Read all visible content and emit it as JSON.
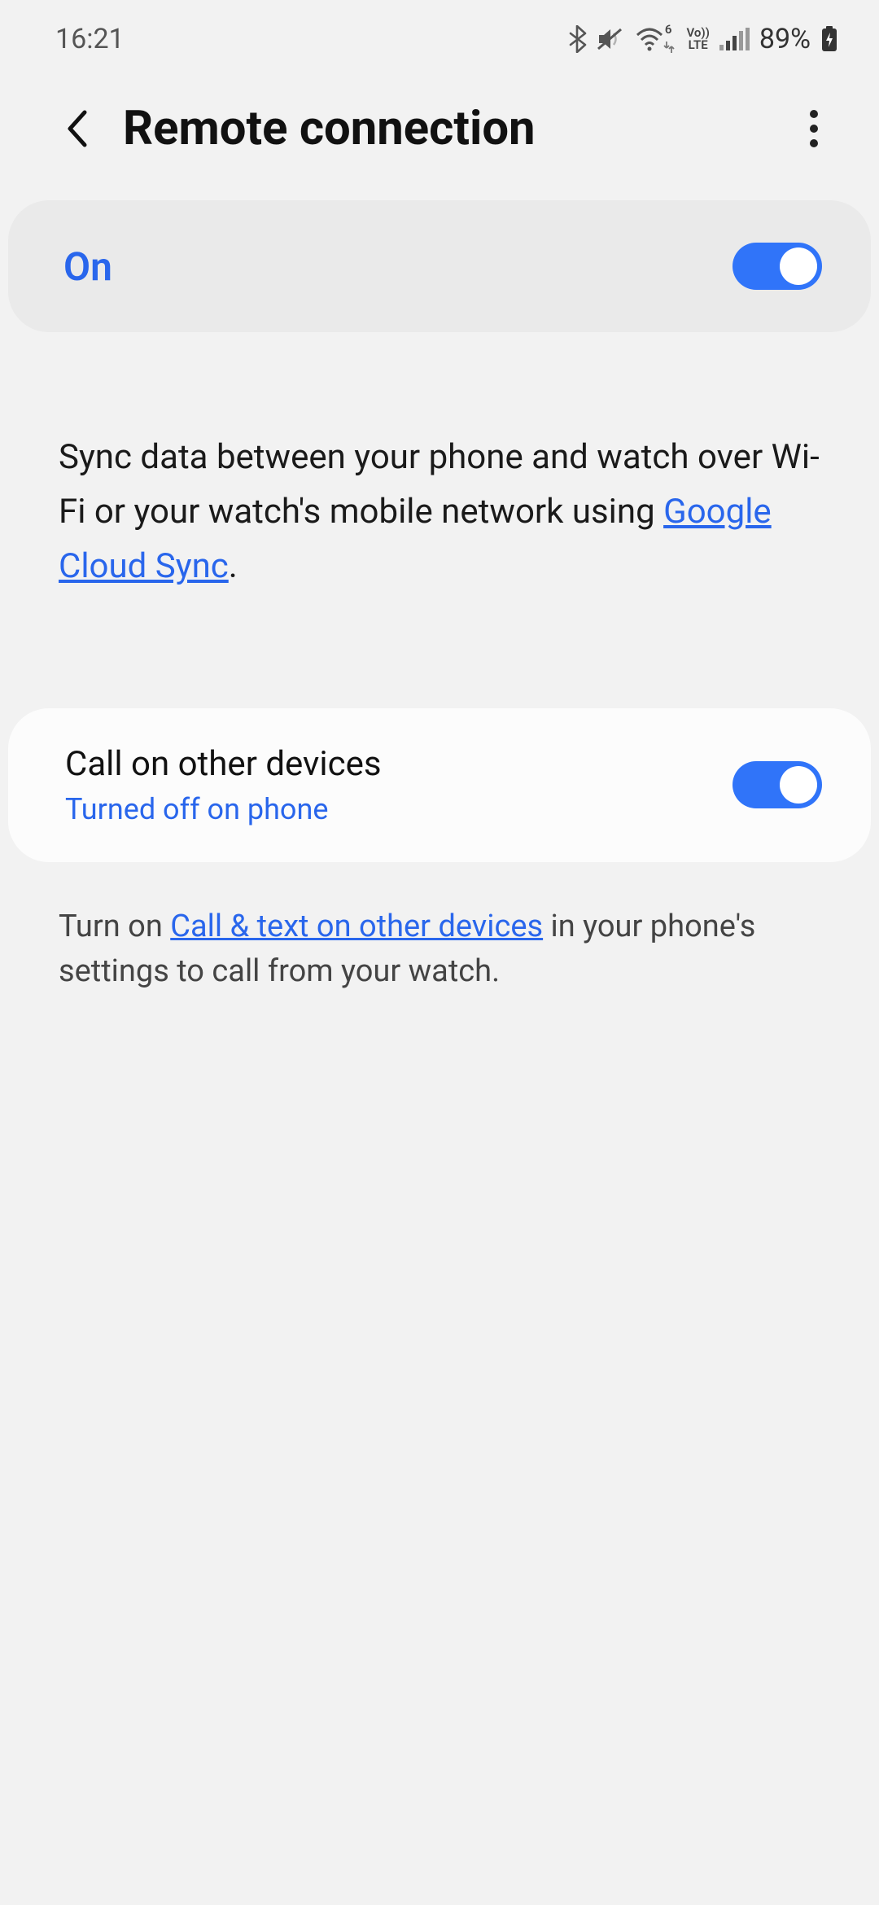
{
  "status": {
    "time": "16:21",
    "battery_text": "89%",
    "wifi_label": "6",
    "volte_top": "Vo))",
    "volte_bottom": "LTE"
  },
  "header": {
    "title": "Remote connection"
  },
  "on_card": {
    "label": "On"
  },
  "sync": {
    "pre": "Sync data between your phone and watch over Wi-Fi or your watch's mobile network using ",
    "link": "Google Cloud Sync",
    "post": "."
  },
  "call_card": {
    "title": "Call on other devices",
    "subtitle": "Turned off on phone"
  },
  "hint": {
    "pre": "Turn on ",
    "link": "Call & text on other devices",
    "post": " in your phone's settings to call from your watch."
  }
}
